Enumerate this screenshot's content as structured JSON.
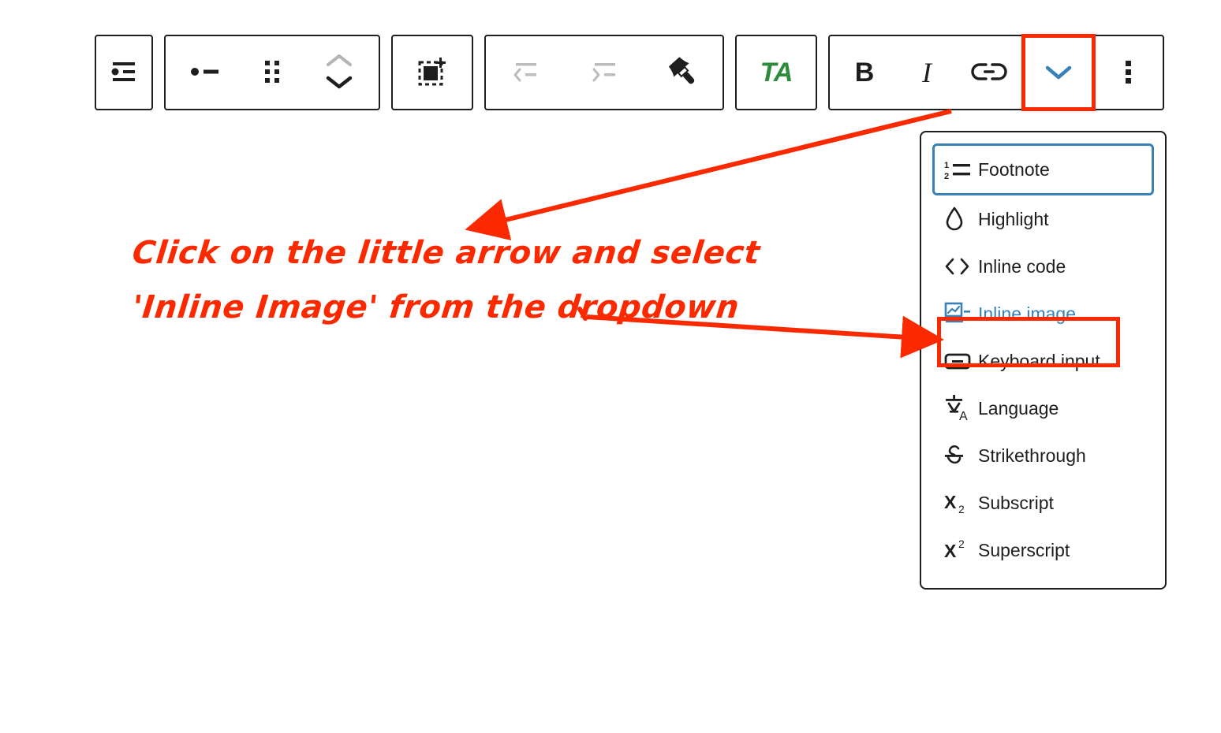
{
  "toolbar": {
    "groups": [
      {
        "name": "block-type-group",
        "buttons": [
          {
            "id": "list-view",
            "icon": "list-view-icon",
            "label": "List view",
            "state": "enabled"
          }
        ]
      },
      {
        "name": "block-controls-group",
        "buttons": [
          {
            "id": "list-block",
            "icon": "bullet-list-icon",
            "label": "List",
            "state": "enabled"
          },
          {
            "id": "drag-handle",
            "icon": "drag-handle-icon",
            "label": "Drag",
            "state": "enabled"
          },
          {
            "id": "move-updown",
            "icon": "move-up-down-icon",
            "label": "Move up / Move down",
            "state": "move-up-disabled"
          }
        ]
      },
      {
        "name": "select-parent-group",
        "buttons": [
          {
            "id": "select-parent",
            "icon": "select-block-icon",
            "label": "Select parent block",
            "state": "enabled"
          }
        ]
      },
      {
        "name": "indent-group",
        "buttons": [
          {
            "id": "outdent",
            "icon": "outdent-icon",
            "label": "Outdent",
            "state": "disabled"
          },
          {
            "id": "indent",
            "icon": "indent-icon",
            "label": "Indent",
            "state": "disabled"
          },
          {
            "id": "format-painter",
            "icon": "paintbrush-icon",
            "label": "Paste styles",
            "state": "enabled"
          }
        ]
      },
      {
        "name": "text-style-group",
        "buttons": [
          {
            "id": "text-appearance",
            "icon": "ta-icon",
            "label": "TA",
            "state": "enabled"
          }
        ]
      },
      {
        "name": "inline-format-group",
        "buttons": [
          {
            "id": "bold",
            "icon": "bold-icon",
            "label": "B",
            "state": "enabled"
          },
          {
            "id": "italic",
            "icon": "italic-icon",
            "label": "I",
            "state": "enabled"
          },
          {
            "id": "link",
            "icon": "link-icon",
            "label": "Link",
            "state": "enabled"
          },
          {
            "id": "more-formats",
            "icon": "chevron-down-icon",
            "label": "More",
            "state": "highlighted-open"
          },
          {
            "id": "options",
            "icon": "more-vertical-icon",
            "label": "Options",
            "state": "enabled"
          }
        ]
      }
    ]
  },
  "dropdown": {
    "name": "more-rich-text-controls-menu",
    "items": [
      {
        "label": "Footnote",
        "icon": "footnote-icon",
        "state": "focused"
      },
      {
        "label": "Highlight",
        "icon": "highlight-drop-icon",
        "state": "normal"
      },
      {
        "label": "Inline code",
        "icon": "inline-code-icon",
        "state": "normal"
      },
      {
        "label": "Inline image",
        "icon": "inline-image-icon",
        "state": "selected"
      },
      {
        "label": "Keyboard input",
        "icon": "keyboard-icon",
        "state": "normal"
      },
      {
        "label": "Language",
        "icon": "translate-icon",
        "state": "normal"
      },
      {
        "label": "Strikethrough",
        "icon": "strikethrough-icon",
        "state": "normal"
      },
      {
        "label": "Subscript",
        "icon": "subscript-icon",
        "state": "normal"
      },
      {
        "label": "Superscript",
        "icon": "superscript-icon",
        "state": "normal"
      }
    ]
  },
  "annotation": {
    "line1": "Click on the little arrow and select",
    "line2": "'Inline Image' from the dropdown",
    "color": "#fa2900",
    "arrows": [
      {
        "name": "arrow-to-chevron-button",
        "from": "chevron-down-button",
        "to": "annotation-text"
      },
      {
        "name": "arrow-to-inline-image",
        "from": "annotation-text",
        "to": "inline-image-menu-item"
      }
    ]
  },
  "colors": {
    "accent_blue": "#3982b8",
    "annotation_red": "#fa2900",
    "text_dark": "#1e1e1e",
    "disabled_gray": "#b5b5b5",
    "ta_green": "#2e8b3d"
  }
}
